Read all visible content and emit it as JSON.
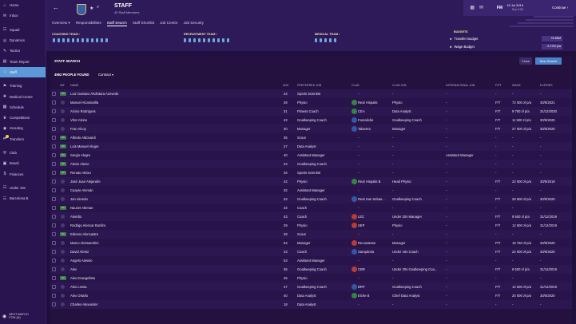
{
  "sidebar": {
    "items": [
      {
        "label": "Home",
        "icon": "home-icon",
        "glyph": "⌂"
      },
      {
        "label": "Inbox",
        "icon": "inbox-icon",
        "glyph": "✉"
      },
      {
        "label": "Squad",
        "icon": "squad-icon",
        "glyph": "☷"
      },
      {
        "label": "Dynamics",
        "icon": "dynamics-icon",
        "glyph": "◎"
      },
      {
        "label": "Tactics",
        "icon": "tactics-icon",
        "glyph": "✎"
      },
      {
        "label": "Team Report",
        "icon": "report-icon",
        "glyph": "▤"
      },
      {
        "label": "Staff",
        "icon": "staff-icon",
        "glyph": "☺",
        "active": true
      },
      {
        "label": "Training",
        "icon": "training-icon",
        "glyph": "⚑"
      },
      {
        "label": "Medical Centre",
        "icon": "medical-icon",
        "glyph": "✚"
      },
      {
        "label": "Schedule",
        "icon": "schedule-icon",
        "glyph": "▦"
      },
      {
        "label": "Competitions",
        "icon": "competitions-icon",
        "glyph": "♛"
      },
      {
        "label": "Scouting",
        "icon": "scouting-icon",
        "glyph": "◉"
      },
      {
        "label": "Transfers",
        "icon": "transfers-icon",
        "glyph": "⇄",
        "badge": true
      },
      {
        "label": "Club",
        "icon": "club-icon",
        "glyph": "⛨"
      },
      {
        "label": "Board",
        "icon": "board-icon",
        "glyph": "▣"
      },
      {
        "label": "Finances",
        "icon": "finances-icon",
        "glyph": "$"
      },
      {
        "label": "Under 19s",
        "icon": "under19-icon",
        "glyph": "☷"
      },
      {
        "label": "Barcelona B",
        "icon": "barcelonab-icon",
        "glyph": "☷"
      }
    ],
    "next_match_label": "NEXT MATCH",
    "next_match_opponent": "FCM (A)"
  },
  "header": {
    "title": "STAFF",
    "subtitle": "40 Staff Members",
    "fm_label": "FM",
    "date": "15 Jul 2019",
    "time": "Sun 0:00",
    "continue_label": "Continue",
    "tabs": [
      "Overview ▾",
      "Responsibilities",
      "Staff Search",
      "Staff Shortlist",
      "Job Centre",
      "Job Security"
    ],
    "active_tab": 2,
    "coaching_team": "COACHING TEAM ›",
    "recruitment_team": "RECRUITMENT TEAM ›",
    "medical_team": "MEDICAL TEAM ›",
    "budgets_label": "BUDGETS",
    "transfer_budget_label": "Transfer Budget",
    "transfer_budget_value": "76.88M",
    "wage_budget_label": "Wage Budget",
    "wage_budget_value": "2.27M p/a"
  },
  "panel": {
    "title": "STAFF SEARCH",
    "found": "4962 PEOPLE FOUND",
    "contract_filter": "Contract ▾",
    "close_label": "Close",
    "new_search_label": "New Search"
  },
  "columns": {
    "inf": "INF",
    "name": "NAME",
    "age": "AGE",
    "preferred_job": "PREFERRED JOB",
    "club": "CLUB",
    "club_job": "CLUB JOB",
    "international_job": "INTERNATIONAL JOB",
    "ft_pt": "F/PT",
    "wage": "WAGE",
    "expires": "EXPIRES"
  },
  "rows": [
    {
      "name": "Luiz Gustavo Alcântara Azevedo",
      "age": "24",
      "job": "Sports Scientist",
      "club": "-",
      "club_job": "-",
      "intl": "-",
      "ft": "-",
      "wage": "-",
      "exp": "-",
      "pa": "PA",
      "badge": ""
    },
    {
      "name": "Manuel Alcantarilla",
      "age": "28",
      "job": "Physio",
      "club": "Real Hispalis",
      "club_job": "Physio",
      "intl": "-",
      "ft": "F/T",
      "wage": "72 000 zł p/a",
      "exp": "30/6/2021",
      "pa": "",
      "badge": "#2e8a3a"
    },
    {
      "name": "Alcino Rodrigues",
      "age": "31",
      "job": "Fitness Coach",
      "club": "CEA",
      "club_job": "Data Analyst",
      "intl": "-",
      "ft": "F/T",
      "wage": "9 750 zł p/a",
      "exp": "31/12/2020",
      "pa": "",
      "badge": "#2e8a3a"
    },
    {
      "name": "Vítor Alcino",
      "age": "43",
      "job": "Goalkeeping Coach",
      "club": "Famalicão",
      "club_job": "Goalkeeping Coach",
      "intl": "-",
      "ft": "F/T",
      "wage": "11 500 zł p/a",
      "exp": "30/6/2020",
      "pa": "",
      "badge": "#2f5aa8"
    },
    {
      "name": "Fran Alcoy",
      "age": "40",
      "job": "Manager",
      "club": "Talavera",
      "club_job": "Manager",
      "intl": "-",
      "ft": "F/T",
      "wage": "27 000 zł p/a",
      "exp": "30/6/2020",
      "pa": "",
      "badge": "#2f5aa8"
    },
    {
      "name": "Alfredo Aldovardi",
      "age": "35",
      "job": "Scout",
      "club": "-",
      "club_job": "-",
      "intl": "-",
      "ft": "-",
      "wage": "-",
      "exp": "-",
      "pa": "PA",
      "badge": ""
    },
    {
      "name": "Luis Manuel Alegre",
      "age": "27",
      "job": "Data Analyst",
      "club": "-",
      "club_job": "-",
      "intl": "-",
      "ft": "-",
      "wage": "-",
      "exp": "-",
      "pa": "PA",
      "badge": ""
    },
    {
      "name": "Sergio Alegre",
      "age": "40",
      "job": "Assistant Manager",
      "club": "-",
      "club_job": "-",
      "intl": "Assistant Manager",
      "ft": "-",
      "wage": "-",
      "exp": "-",
      "pa": "PA",
      "badge": ""
    },
    {
      "name": "Alexis Aleixo",
      "age": "43",
      "job": "Goalkeeping Coach",
      "club": "-",
      "club_job": "-",
      "intl": "-",
      "ft": "-",
      "wage": "-",
      "exp": "-",
      "pa": "PA",
      "badge": ""
    },
    {
      "name": "Renato Aleixo",
      "age": "26",
      "job": "Sports Scientist",
      "club": "-",
      "club_job": "-",
      "intl": "-",
      "ft": "-",
      "wage": "-",
      "exp": "-",
      "pa": "PA",
      "badge": ""
    },
    {
      "name": "José Juan Alejandre",
      "age": "42",
      "job": "Physio",
      "club": "Real Hispalis B",
      "club_job": "Head Physio",
      "intl": "-",
      "ft": "F/T",
      "wage": "22 000 zł p/a",
      "exp": "30/6/2019",
      "pa": "",
      "badge": "#2e8a3a"
    },
    {
      "name": "Cuayre Alemán",
      "age": "32",
      "job": "Assistant Manager",
      "club": "-",
      "club_job": "-",
      "intl": "-",
      "ft": "-",
      "wage": "-",
      "exp": "-",
      "pa": "",
      "badge": ""
    },
    {
      "name": "Jon Alemán",
      "age": "33",
      "job": "Goalkeeping Coach",
      "club": "Real San Sebas...",
      "club_job": "Goalkeeping Coach",
      "intl": "-",
      "ft": "F/T",
      "wage": "26 500 zł p/a",
      "exp": "30/6/2020",
      "pa": "",
      "badge": "#2f5aa8"
    },
    {
      "name": "Nauzet Aleman",
      "age": "33",
      "job": "Coach",
      "club": "-",
      "club_job": "-",
      "intl": "-",
      "ft": "-",
      "wage": "-",
      "exp": "-",
      "pa": "PA",
      "badge": ""
    },
    {
      "name": "Alemão",
      "age": "43",
      "job": "Coach",
      "club": "LEC",
      "club_job": "Under 20s Manager",
      "intl": "-",
      "ft": "F/T",
      "wage": "9 500 zł p/a",
      "exp": "31/12/2019",
      "pa": "",
      "badge": "#c0392b"
    },
    {
      "name": "Rodrigo Alencar Bonfim",
      "age": "29",
      "job": "Physio",
      "club": "SEP",
      "club_job": "Physio",
      "intl": "-",
      "ft": "F/T",
      "wage": "12 500 zł p/a",
      "exp": "31/12/2019",
      "pa": "",
      "badge": "#c0392b"
    },
    {
      "name": "Edneno Alencastre",
      "age": "28",
      "job": "Scout",
      "club": "-",
      "club_job": "-",
      "intl": "-",
      "ft": "-",
      "wage": "-",
      "exp": "-",
      "pa": "PA",
      "badge": ""
    },
    {
      "name": "Marco Alessandrini",
      "age": "64",
      "job": "Manager",
      "club": "Recanatese",
      "club_job": "Manager",
      "intl": "-",
      "ft": "P/T",
      "wage": "18 750 zł p/a",
      "exp": "30/6/2020",
      "pa": "",
      "badge": "#c0392b"
    },
    {
      "name": "David Alessi",
      "age": "43",
      "job": "Coach",
      "club": "Sampdoria",
      "club_job": "Under 18s Coach",
      "intl": "-",
      "ft": "F/T",
      "wage": "22 000 zł p/a",
      "exp": "30/6/2020",
      "pa": "",
      "badge": "#2f5aa8"
    },
    {
      "name": "Angelo Alessio",
      "age": "53",
      "job": "Assistant Manager",
      "club": "-",
      "club_job": "-",
      "intl": "-",
      "ft": "-",
      "wage": "-",
      "exp": "-",
      "pa": "",
      "badge": ""
    },
    {
      "name": "Alex",
      "age": "36",
      "job": "Goalkeeping Coach",
      "club": "CBR",
      "club_job": "Under 20s Goalkeeping Coa...",
      "intl": "-",
      "ft": "F/T",
      "wage": "6 500 zł p/a",
      "exp": "31/12/2019",
      "pa": "",
      "badge": "#c0392b"
    },
    {
      "name": "Alex Evangelista",
      "age": "45",
      "job": "Physio",
      "club": "-",
      "club_job": "-",
      "intl": "-",
      "ft": "-",
      "wage": "-",
      "exp": "-",
      "pa": "PA",
      "badge": ""
    },
    {
      "name": "Alex Lessa",
      "age": "47",
      "job": "Goalkeeping Coach",
      "club": "BRP",
      "club_job": "Goalkeeping Coach",
      "intl": "-",
      "ft": "F/T",
      "wage": "12 500 zł p/a",
      "exp": "31/12/2019",
      "pa": "",
      "badge": "#2f5aa8"
    },
    {
      "name": "Alex Ortaño",
      "age": "40",
      "job": "Data Analyst",
      "club": "Elche B",
      "club_job": "Chief Data Analyst",
      "intl": "-",
      "ft": "F/T",
      "wage": "20 000 zł p/a",
      "exp": "30/6/2020",
      "pa": "",
      "badge": "#2e8a3a"
    },
    {
      "name": "Charles Alexander",
      "age": "18",
      "job": "Data Analyst",
      "club": "-",
      "club_job": "-",
      "intl": "-",
      "ft": "-",
      "wage": "-",
      "exp": "-",
      "pa": "",
      "badge": ""
    }
  ]
}
